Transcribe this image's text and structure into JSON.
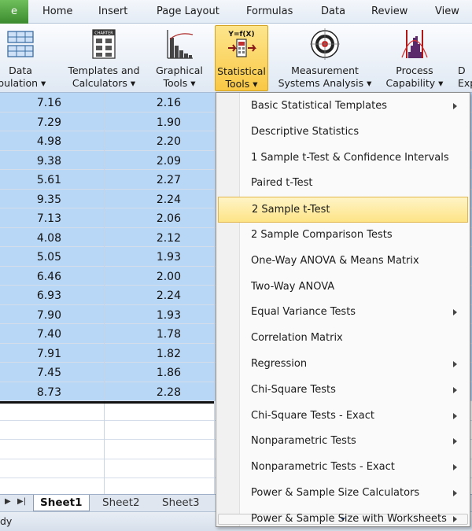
{
  "ribbon": {
    "file_tab": "e",
    "tabs": [
      "Home",
      "Insert",
      "Page Layout",
      "Formulas",
      "Data",
      "Review",
      "View"
    ],
    "buttons": [
      {
        "line1": "Data",
        "line2": "ipulation"
      },
      {
        "line1": "Templates and",
        "line2": "Calculators"
      },
      {
        "line1": "Graphical",
        "line2": "Tools"
      },
      {
        "line1": "Statistical",
        "line2": "Tools"
      },
      {
        "line1": "Measurement",
        "line2": "Systems Analysis"
      },
      {
        "line1": "Process",
        "line2": "Capability"
      },
      {
        "line1": "D",
        "line2": "Exp"
      }
    ],
    "icons": {
      "charter_text": "CHARTER",
      "yfx_text": "Y=f(X)"
    }
  },
  "sheet": {
    "col_a": [
      "7.16",
      "7.29",
      "4.98",
      "9.38",
      "5.61",
      "9.35",
      "7.13",
      "4.08",
      "5.05",
      "6.46",
      "6.93",
      "7.90",
      "7.40",
      "7.91",
      "7.45",
      "8.73"
    ],
    "col_b": [
      "2.16",
      "1.90",
      "2.20",
      "2.09",
      "2.27",
      "2.24",
      "2.06",
      "2.12",
      "1.93",
      "2.00",
      "2.24",
      "1.93",
      "1.78",
      "1.82",
      "1.86",
      "2.28"
    ],
    "tabs": [
      "Sheet1",
      "Sheet2",
      "Sheet3"
    ],
    "status": "dy"
  },
  "menu": {
    "items": [
      {
        "label": "Basic Statistical Templates",
        "submenu": true
      },
      {
        "label": "Descriptive Statistics",
        "submenu": false
      },
      {
        "label": "1 Sample t-Test & Confidence Intervals",
        "submenu": false
      },
      {
        "label": "Paired t-Test",
        "submenu": false
      },
      {
        "label": "2 Sample t-Test",
        "submenu": false,
        "highlighted": true
      },
      {
        "label": "2 Sample Comparison Tests",
        "submenu": false
      },
      {
        "label": "One-Way ANOVA & Means Matrix",
        "submenu": false
      },
      {
        "label": "Two-Way ANOVA",
        "submenu": false
      },
      {
        "label": "Equal Variance Tests",
        "submenu": true
      },
      {
        "label": "Correlation Matrix",
        "submenu": false
      },
      {
        "label": "Regression",
        "submenu": true
      },
      {
        "label": "Chi-Square Tests",
        "submenu": true
      },
      {
        "label": "Chi-Square Tests - Exact",
        "submenu": true
      },
      {
        "label": "Nonparametric Tests",
        "submenu": true
      },
      {
        "label": "Nonparametric Tests - Exact",
        "submenu": true
      },
      {
        "label": "Power & Sample Size Calculators",
        "submenu": true
      },
      {
        "label": "Power & Sample Size with Worksheets",
        "submenu": true
      }
    ]
  },
  "colors": {
    "selection": "#b8d6f5",
    "menu_highlight": "#fde487",
    "active_button": "#f9c845",
    "file_tab": "#3b8a2e"
  }
}
